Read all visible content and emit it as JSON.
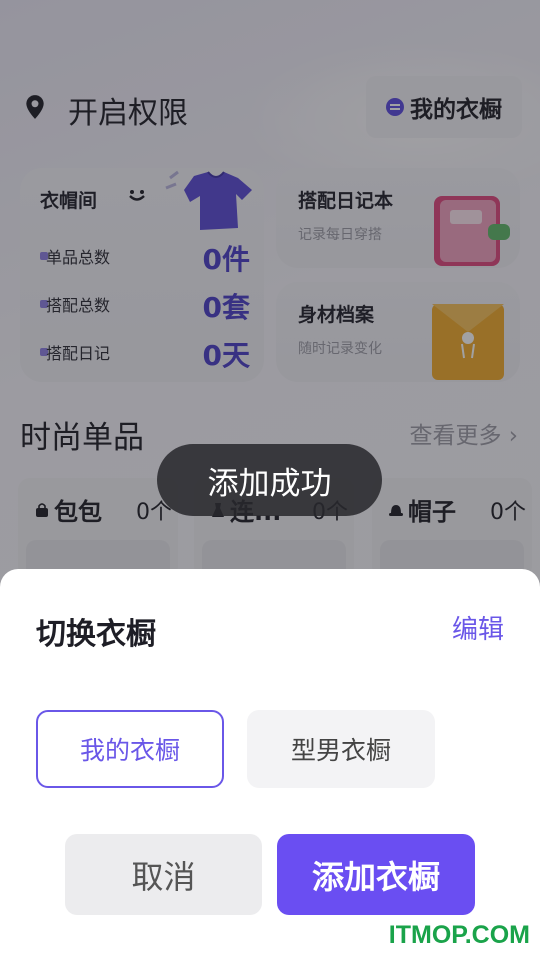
{
  "topbar": {
    "location_label": "开启权限",
    "wardrobe_button": "我的衣橱"
  },
  "wardrobe_card": {
    "title": "衣帽间",
    "stats": [
      {
        "label": "单品总数",
        "value": "0件"
      },
      {
        "label": "搭配总数",
        "value": "0套"
      },
      {
        "label": "搭配日记",
        "value": "0天"
      }
    ]
  },
  "diary_card": {
    "title": "搭配日记本",
    "subtitle": "记录每日穿搭"
  },
  "body_card": {
    "title": "身材档案",
    "subtitle": "随时记录变化"
  },
  "section": {
    "title": "时尚单品",
    "more": "查看更多"
  },
  "categories": [
    {
      "label": "包包",
      "count": "0个",
      "icon": "bag-icon"
    },
    {
      "label": "连...",
      "count": "0个",
      "icon": "dress-icon"
    },
    {
      "label": "帽子",
      "count": "0个",
      "icon": "hat-icon"
    }
  ],
  "toast": {
    "text": "添加成功"
  },
  "sheet": {
    "title": "切换衣橱",
    "edit": "编辑",
    "options": [
      "我的衣橱",
      "型男衣橱"
    ],
    "cancel": "取消",
    "add": "添加衣橱"
  },
  "watermark": "ITMOP.COM",
  "colors": {
    "accent": "#6a4ef2",
    "stat_value": "#4b3fc8",
    "watermark": "#1aa34a"
  }
}
